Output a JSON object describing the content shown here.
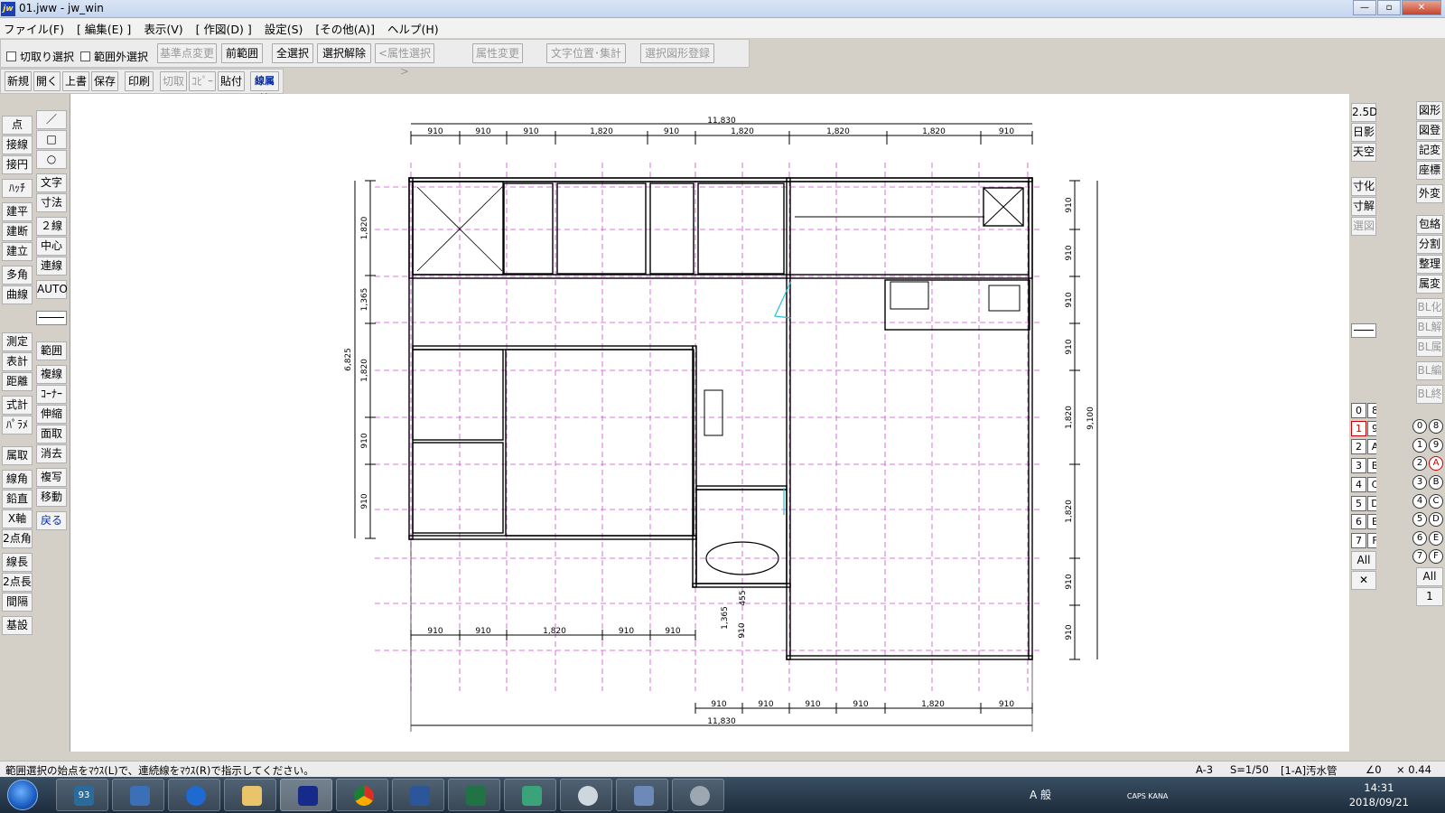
{
  "window": {
    "title": "01.jww - jw_win",
    "logo": "jw",
    "controls": [
      "—",
      "▫",
      "✕"
    ]
  },
  "menu": [
    "ファイル(F)",
    "[ 編集(E) ]",
    "表示(V)",
    "[ 作図(D) ]",
    "設定(S)",
    "[その他(A)]",
    "ヘルプ(H)"
  ],
  "toolbar1": {
    "chk_cut": "切取り選択",
    "chk_outside": "範囲外選択",
    "buttons": [
      "基準点変更",
      "前範囲",
      "全選択",
      "選択解除",
      "<属性選択>",
      "属性変更",
      "文字位置･集計",
      "選択図形登録"
    ]
  },
  "toolbar2": [
    "新規",
    "開く",
    "上書",
    "保存",
    "印刷",
    "切取",
    "ｺﾋﾟｰ",
    "貼付",
    "線属性"
  ],
  "left_col1": [
    "点",
    "接線",
    "接円",
    "ﾊｯﾁ",
    "建平",
    "建断",
    "建立",
    "多角形",
    "曲線",
    "測定",
    "表計",
    "距離",
    "式計",
    "ﾊﾟﾗﾒ",
    "属取",
    "線角",
    "鉛直",
    "X軸",
    "2点角",
    "線長",
    "2点長",
    "間隔",
    "基設"
  ],
  "left_col2": [
    "／",
    "□",
    "○",
    "文字",
    "寸法",
    "２線",
    "中心線",
    "連線",
    "AUTO",
    "範囲",
    "複線",
    "ｺｰﾅｰ",
    "伸縮",
    "面取",
    "消去",
    "複写",
    "移動",
    "戻る"
  ],
  "right_col1": [
    "2.5D",
    "日影",
    "天空",
    "寸化",
    "寸解",
    "選図"
  ],
  "right_col2": [
    "図形",
    "図登",
    "記変",
    "座標",
    "外変",
    "包絡",
    "分割",
    "整理",
    "属変",
    "BL化",
    "BL解",
    "BL属",
    "BL編",
    "BL終"
  ],
  "layer_groups": [
    "0",
    "1",
    "2",
    "3",
    "4",
    "5",
    "6",
    "7"
  ],
  "layer_groups2": [
    "8",
    "9",
    "A",
    "B",
    "C",
    "D",
    "E",
    "F"
  ],
  "layers": [
    "0",
    "1",
    "2",
    "3",
    "4",
    "5",
    "6",
    "7"
  ],
  "layers2": [
    "8",
    "9",
    "A",
    "B",
    "C",
    "D",
    "E",
    "F"
  ],
  "all_label": "All",
  "one_label": "1",
  "drawing": {
    "top_total": "11,830",
    "top_dims": [
      "910",
      "910",
      "910",
      "1,820",
      "910",
      "1,820",
      "1,820",
      "1,820",
      "910"
    ],
    "left_total": "6,825",
    "left_dims": [
      "1,820",
      "1,365",
      "1,820",
      "910",
      "910"
    ],
    "right_total": "9,100",
    "right_dims": [
      "910",
      "910",
      "910",
      "910",
      "1,820",
      "1,820",
      "910",
      "910"
    ],
    "bottom_dims_left": [
      "910",
      "910",
      "1,820",
      "910",
      "910"
    ],
    "bottom_small": [
      "1,365",
      "455",
      "910"
    ],
    "bottom_dims_right": [
      "910",
      "910",
      "910",
      "910",
      "1,820",
      "910"
    ],
    "bottom_total": "11,830"
  },
  "status": {
    "message": "範囲選択の始点をﾏｳｽ(L)で、連続線をﾏｳｽ(R)で指示してください。",
    "paper": "A-3",
    "scale": "S=1/50",
    "layer": "[1-A]汚水管",
    "angle": "∠0",
    "factor": "× 0.44"
  },
  "taskbar": {
    "apps": [
      "93",
      "explorer",
      "thunderbird",
      "folder",
      "jww",
      "chrome",
      "word",
      "excel",
      "feather",
      "ccleaner",
      "city",
      "speaker"
    ],
    "tray_text": "A 般",
    "caps": "CAPS KANA",
    "time": "14:31",
    "date": "2018/09/21"
  }
}
